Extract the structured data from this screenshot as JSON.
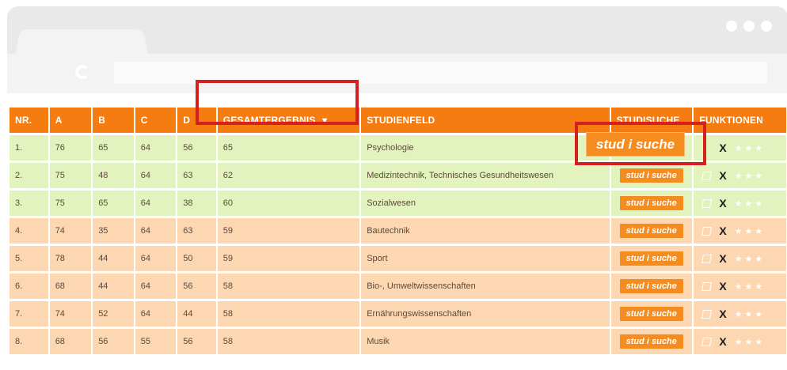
{
  "headers": [
    "NR.",
    "A",
    "B",
    "C",
    "D",
    "GESAMTERGEBNIS",
    "STUDIENFELD",
    "STUDISUCHE",
    "FUNKTIONEN"
  ],
  "sort_indicator": "▼",
  "studisuche_label": "stud i suche",
  "delete_glyph": "X",
  "stars": "★★★",
  "rows": [
    {
      "nr": "1.",
      "a": "76",
      "b": "65",
      "c": "64",
      "d": "56",
      "g": "65",
      "feld": "Psychologie",
      "tone": "green"
    },
    {
      "nr": "2.",
      "a": "75",
      "b": "48",
      "c": "64",
      "d": "63",
      "g": "62",
      "feld": "Medizintechnik, Technisches Gesundheitswesen",
      "tone": "green"
    },
    {
      "nr": "3.",
      "a": "75",
      "b": "65",
      "c": "64",
      "d": "38",
      "g": "60",
      "feld": "Sozialwesen",
      "tone": "green"
    },
    {
      "nr": "4.",
      "a": "74",
      "b": "35",
      "c": "64",
      "d": "63",
      "g": "59",
      "feld": "Bautechnik",
      "tone": "orange"
    },
    {
      "nr": "5.",
      "a": "78",
      "b": "44",
      "c": "64",
      "d": "50",
      "g": "59",
      "feld": "Sport",
      "tone": "orange"
    },
    {
      "nr": "6.",
      "a": "68",
      "b": "44",
      "c": "64",
      "d": "56",
      "g": "58",
      "feld": "Bio-, Umweltwissenschaften",
      "tone": "orange"
    },
    {
      "nr": "7.",
      "a": "74",
      "b": "52",
      "c": "64",
      "d": "44",
      "g": "58",
      "feld": "Ernährungswissenschaften",
      "tone": "orange"
    },
    {
      "nr": "8.",
      "a": "68",
      "b": "56",
      "c": "55",
      "d": "56",
      "g": "58",
      "feld": "Musik",
      "tone": "orange"
    }
  ],
  "colors": {
    "accent": "#f47c11",
    "highlight": "#d52020",
    "row_green": "#e2f3bd",
    "row_orange": "#fdd7b2"
  }
}
